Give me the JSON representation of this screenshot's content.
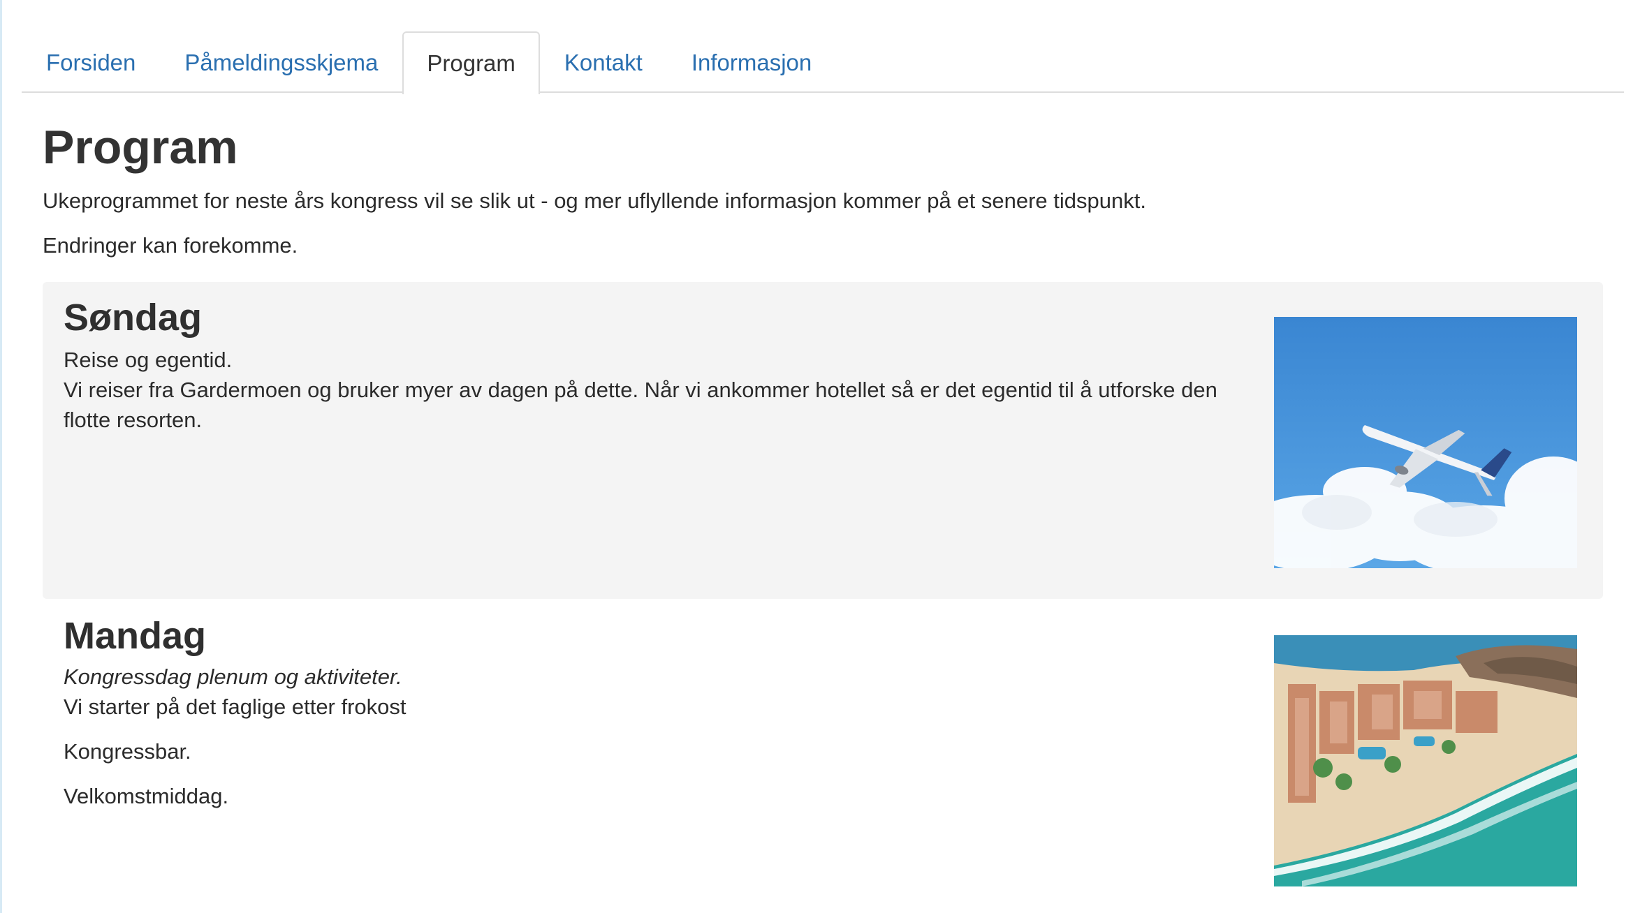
{
  "nav": {
    "tabs": [
      {
        "label": "Forsiden",
        "active": false
      },
      {
        "label": "Påmeldingsskjema",
        "active": false
      },
      {
        "label": "Program",
        "active": true
      },
      {
        "label": "Kontakt",
        "active": false
      },
      {
        "label": "Informasjon",
        "active": false
      }
    ]
  },
  "page": {
    "title": "Program",
    "intro": "Ukeprogrammet for neste års kongress vil se slik ut - og mer uflyllende informasjon kommer på et senere tidspunkt.",
    "note": "Endringer kan forekomme."
  },
  "days": {
    "sunday": {
      "heading": "Søndag",
      "line1": "Reise og egentid.",
      "line2": "Vi reiser fra Gardermoen og bruker myer av dagen på dette. Når vi ankommer hotellet så er det egentid til å utforske den flotte resorten."
    },
    "monday": {
      "heading": "Mandag",
      "subtitle": "Kongressdag plenum og aktiviteter.",
      "line1": "Vi starter på det faglige etter frokost",
      "line2": "Kongressbar.",
      "line3": "Velkomstmiddag."
    }
  },
  "colors": {
    "link": "#2a6fb0",
    "panel": "#f4f4f4",
    "sky": "#3f8fd8",
    "sea": "#2aa8a0"
  }
}
